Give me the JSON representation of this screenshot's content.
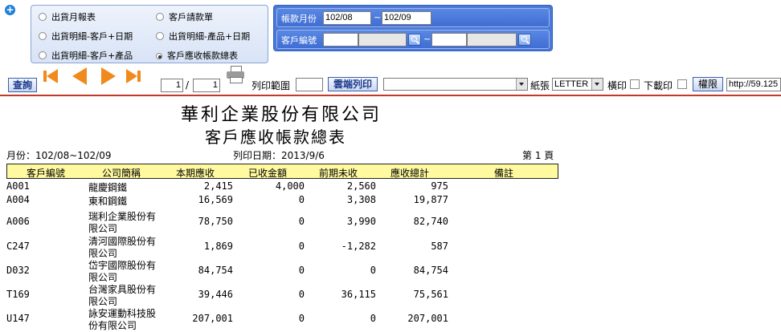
{
  "filters": {
    "report_types": [
      {
        "label": "出貨月報表",
        "selected": false
      },
      {
        "label": "客戶請款單",
        "selected": false
      },
      {
        "label": "出貨明細-客戶+日期",
        "selected": false
      },
      {
        "label": "出貨明細-產品+日期",
        "selected": false
      },
      {
        "label": "出貨明細-客戶+產品",
        "selected": false
      },
      {
        "label": "客戶應收帳款總表",
        "selected": true
      }
    ],
    "period_label": "帳款月份",
    "period_from": "102/08",
    "period_sep": "~",
    "period_to": "102/09",
    "customer_label": "客戶編號",
    "customer_sep": "~"
  },
  "toolbar": {
    "query_label": "查詢",
    "page_current": "1",
    "page_sep": "/",
    "page_total": "1",
    "print_range_label": "列印範圍",
    "cloud_print_label": "雲端列印",
    "paper_label": "紙張",
    "paper_value": "LETTER",
    "landscape_label": "橫印",
    "download_label": "下載印",
    "permission_label": "權限",
    "url_value": "http://59.125"
  },
  "report": {
    "company": "華利企業股份有限公司",
    "title": "客戶應收帳款總表",
    "period": "月份：102/08~102/09",
    "print_date": "列印日期：2013/9/6",
    "page_info": "第 1 頁",
    "columns": [
      "客戶編號",
      "公司簡稱",
      "本期應收",
      "已收金額",
      "前期未收",
      "應收總計",
      "備註"
    ],
    "rows": [
      {
        "id": "A001",
        "name": [
          "龍慶鋼鐵"
        ],
        "current": "2,415",
        "received": "4,000",
        "prior": "2,560",
        "total": "975"
      },
      {
        "id": "A004",
        "name": [
          "東和鋼鐵"
        ],
        "current": "16,569",
        "received": "0",
        "prior": "3,308",
        "total": "19,877"
      },
      {
        "id": "A006",
        "name": [
          "瑞利企業股份有",
          "限公司"
        ],
        "current": "78,750",
        "received": "0",
        "prior": "3,990",
        "total": "82,740"
      },
      {
        "id": "C247",
        "name": [
          "清河國際股份有",
          "限公司"
        ],
        "current": "1,869",
        "received": "0",
        "prior": "-1,282",
        "total": "587"
      },
      {
        "id": "D032",
        "name": [
          "岱宇國際股份有",
          "限公司"
        ],
        "current": "84,754",
        "received": "0",
        "prior": "0",
        "total": "84,754"
      },
      {
        "id": "T169",
        "name": [
          "台灣家具股份有",
          "限公司"
        ],
        "current": "39,446",
        "received": "0",
        "prior": "36,115",
        "total": "75,561"
      },
      {
        "id": "U147",
        "name": [
          "詠安運動科技股",
          "份有限公司"
        ],
        "current": "207,001",
        "received": "0",
        "prior": "0",
        "total": "207,001"
      }
    ]
  },
  "colors": {
    "accent": "#4a78d8",
    "header_bg": "#fffaa0",
    "divider": "#c0392b",
    "arrow": "#f08a1c"
  }
}
